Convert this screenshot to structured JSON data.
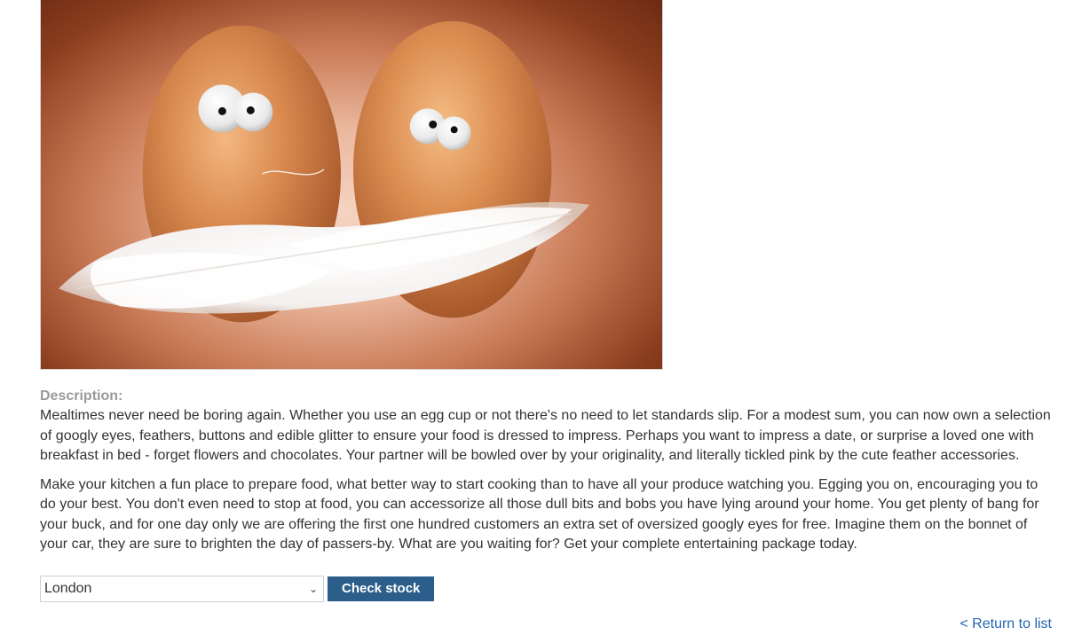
{
  "product": {
    "image_alt": "Two eggs with googly eyes on white feathers",
    "description_label": "Description:",
    "description_paragraphs": [
      "Mealtimes never need be boring again. Whether you use an egg cup or not there's no need to let standards slip. For a modest sum, you can now own a selection of googly eyes, feathers, buttons and edible glitter to ensure your food is dressed to impress. Perhaps you want to impress a date, or surprise a loved one with breakfast in bed - forget flowers and chocolates. Your partner will be bowled over by your originality, and literally tickled pink by the cute feather accessories.",
      "Make your kitchen a fun place to prepare food, what better way to start cooking than to have all your produce watching you. Egging you on, encouraging you to do your best. You don't even need to stop at food, you can accessorize all those dull bits and bobs you have lying around your home. You get plenty of bang for your buck, and for one day only we are offering the first one hundred customers an extra set of oversized googly eyes for free. Imagine them on the bonnet of your car, they are sure to brighten the day of passers-by. What are you waiting for? Get your complete entertaining package today."
    ]
  },
  "stock": {
    "selected_store": "London",
    "check_button_label": "Check stock"
  },
  "nav": {
    "return_link_label": "< Return to list"
  },
  "colors": {
    "button_bg": "#2b5e8a",
    "link": "#2266b0",
    "label": "#9a9a9a",
    "text": "#333333"
  },
  "icons": {
    "select_arrow": "chevron-down-icon"
  }
}
